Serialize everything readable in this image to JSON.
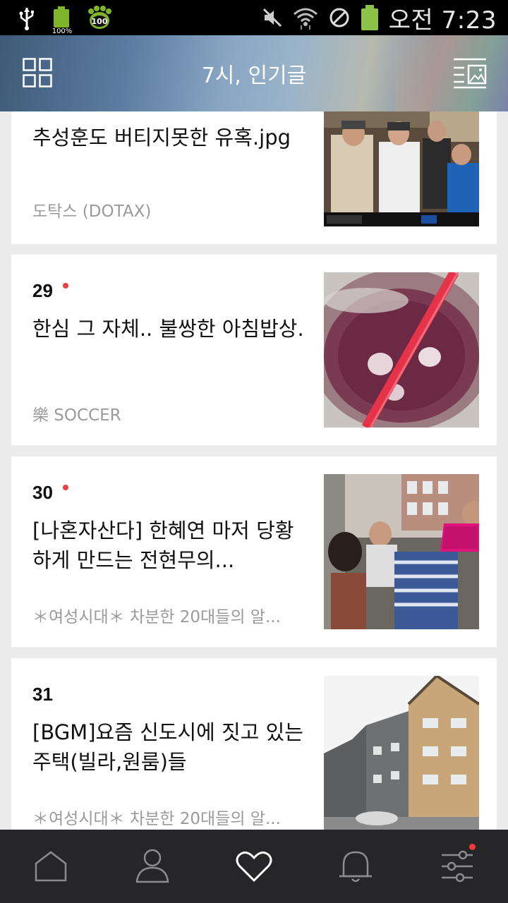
{
  "status_bar": {
    "battery_small_label": "100%",
    "paw_badge": "100",
    "time": "오전 7:23",
    "icons": [
      "usb-icon",
      "battery-icon",
      "paw-icon",
      "mute-icon",
      "wifi-icon",
      "blocked-icon",
      "battery-icon"
    ]
  },
  "header": {
    "title": "7시, 인기글",
    "left_icon": "grid-icon",
    "right_icon": "list-image-icon"
  },
  "cards": [
    {
      "rank": "",
      "title": "추성훈도 버티지못한 유혹.jpg",
      "source": "도탁스 (DOTAX)",
      "thumbnail": "photo of people in winter jackets"
    },
    {
      "rank": "29",
      "new": true,
      "title": "한심 그 자체.. 불쌍한 아침밥상.",
      "source": "樂 SOCCER",
      "thumbnail": "photo of red drink with ice and straw"
    },
    {
      "rank": "30",
      "new": true,
      "title": "[나혼자산다] 한혜연 마저 당황하게 만드는 전현무의...",
      "source": "＊여성시대＊ 차분한 20대들의 알...",
      "thumbnail": "photo of people at clothing rack"
    },
    {
      "rank": "31",
      "new": false,
      "title": "[BGM]요즘 신도시에 짓고 있는 주택(빌라,원룸)들",
      "source": "＊여성시대＊ 차분한 20대들의 알...",
      "thumbnail": "photo of apartment building"
    }
  ],
  "bottom_nav": {
    "items": [
      "home-icon",
      "profile-icon",
      "heart-icon",
      "bell-icon",
      "settings-sliders-icon"
    ],
    "active": "heart-icon",
    "badge_on": "settings-sliders-icon"
  },
  "colors": {
    "accent_dot": "#e8413f",
    "nav_background": "#262628",
    "card_background": "#ffffff",
    "feed_background": "#ececec"
  }
}
